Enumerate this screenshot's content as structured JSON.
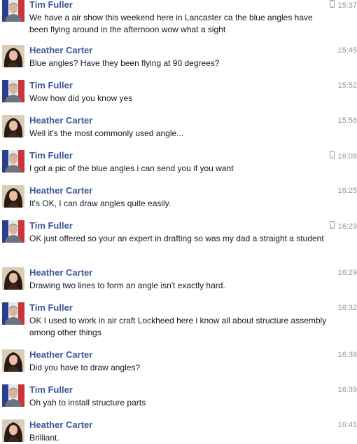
{
  "messages": [
    {
      "sender": "Tim Fuller",
      "avatar": "tim-avatar",
      "time": "15:37",
      "mobile": true,
      "text": "We have a air show this weekend here in Lancaster ca the blue angles have been flying around in the afternoon wow what a sight"
    },
    {
      "sender": "Heather Carter",
      "avatar": "heather-avatar",
      "time": "15:45",
      "mobile": false,
      "text": "Blue angles? Have they been flying at 90 degrees?"
    },
    {
      "sender": "Tim Fuller",
      "avatar": "tim-avatar",
      "time": "15:52",
      "mobile": false,
      "text": "Wow how did you know yes"
    },
    {
      "sender": "Heather Carter",
      "avatar": "heather-avatar",
      "time": "15:56",
      "mobile": false,
      "text": "Well it's the most commonly used angle..."
    },
    {
      "sender": "Tim Fuller",
      "avatar": "tim-avatar",
      "time": "16:08",
      "mobile": true,
      "text": "I got a pic of the blue angles i can send you if you want"
    },
    {
      "sender": "Heather Carter",
      "avatar": "heather-avatar",
      "time": "16:25",
      "mobile": false,
      "text": "It's OK, I can draw angles quite easily."
    },
    {
      "sender": "Tim Fuller",
      "avatar": "tim-avatar",
      "time": "16:29",
      "mobile": true,
      "text": "OK just offered so your an expert in drafting so was my dad a straight a student"
    },
    {
      "sender": "Heather Carter",
      "avatar": "heather-avatar",
      "time": "16:29",
      "mobile": false,
      "text": "Drawing two lines to form an angle isn't exactly hard."
    },
    {
      "sender": "Tim Fuller",
      "avatar": "tim-avatar",
      "time": "16:32",
      "mobile": false,
      "text": "OK I used to work in air craft Lockheed here i know all about structure assembly among other things"
    },
    {
      "sender": "Heather Carter",
      "avatar": "heather-avatar",
      "time": "16:38",
      "mobile": false,
      "text": "Did you have to draw angles?"
    },
    {
      "sender": "Tim Fuller",
      "avatar": "tim-avatar",
      "time": "16:39",
      "mobile": false,
      "text": "Oh yah to install structure parts"
    },
    {
      "sender": "Heather Carter",
      "avatar": "heather-avatar",
      "time": "16:41",
      "mobile": false,
      "text": "Brilliant."
    }
  ],
  "colors": {
    "name": "#3b5998",
    "text": "#141823",
    "time": "#9197a3"
  }
}
